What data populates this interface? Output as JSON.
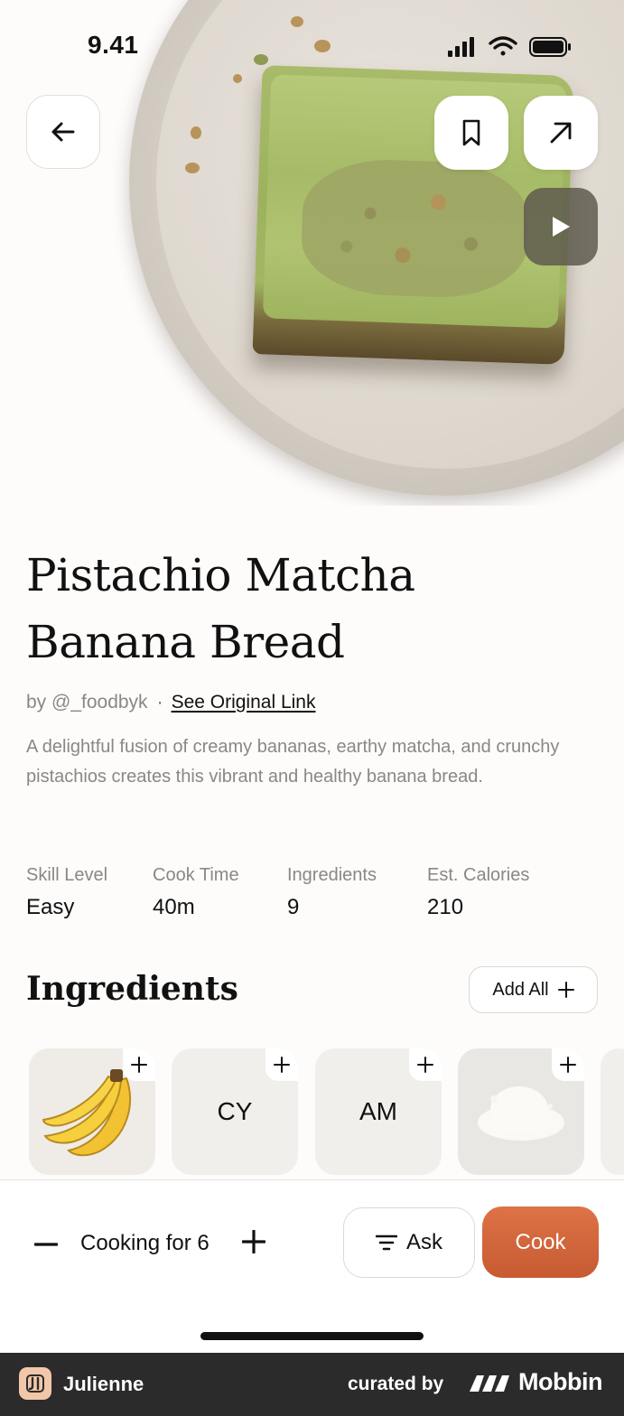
{
  "status_bar": {
    "time": "9.41"
  },
  "hero": {
    "image": "Pistachio matcha banana bread slice on ceramic plate"
  },
  "recipe": {
    "title": "Pistachio Matcha Banana Bread",
    "author": "by @_foodbyk",
    "separator": "·",
    "source_link": "See Original Link",
    "description": "A delightful fusion of creamy bananas, earthy matcha, and crunchy pistachios creates this vibrant and healthy banana bread."
  },
  "stats": [
    {
      "label": "Skill Level",
      "value": "Easy"
    },
    {
      "label": "Cook Time",
      "value": "40m"
    },
    {
      "label": "Ingredients",
      "value": "9"
    },
    {
      "label": "Est. Calories",
      "value": "210"
    }
  ],
  "ingredients": {
    "title": "Ingredients",
    "add_all_label": "Add All",
    "items": [
      {
        "kind": "image",
        "icon": "banana",
        "text": ""
      },
      {
        "kind": "initials",
        "text": "CY"
      },
      {
        "kind": "initials",
        "text": "AM"
      },
      {
        "kind": "image",
        "icon": "flour",
        "text": ""
      }
    ]
  },
  "bottom_bar": {
    "servings_label": "Cooking for 6",
    "ask_label": "Ask",
    "cook_label": "Cook"
  },
  "footer": {
    "app_name": "Julienne",
    "curated_by": "curated by",
    "brand": "Mobbin"
  },
  "colors": {
    "accent": "#d0663c",
    "background": "#fdfcfb",
    "footer": "#2b2b2b"
  }
}
